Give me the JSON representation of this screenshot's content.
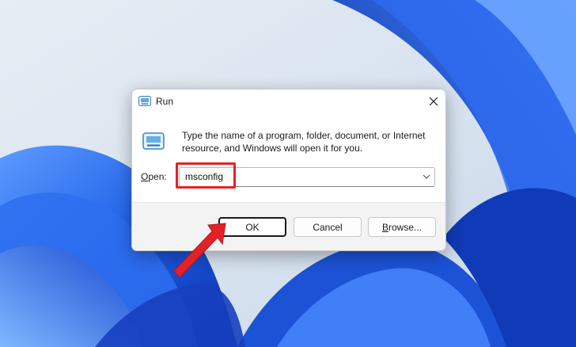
{
  "dialog": {
    "title": "Run",
    "description": "Type the name of a program, folder, document, or Internet resource, and Windows will open it for you.",
    "open_label_mnemonic": "O",
    "open_label_rest": "pen:",
    "open_value": "msconfig"
  },
  "buttons": {
    "ok": "OK",
    "cancel": "Cancel",
    "browse_mnemonic": "B",
    "browse_rest": "rowse..."
  },
  "icons": {
    "title": "run-icon",
    "body": "run-icon",
    "close": "close-icon",
    "dropdown": "chevron-down-icon"
  },
  "colors": {
    "annotation": "#e32227",
    "wallpaper_blue": "#1f5bd8"
  }
}
